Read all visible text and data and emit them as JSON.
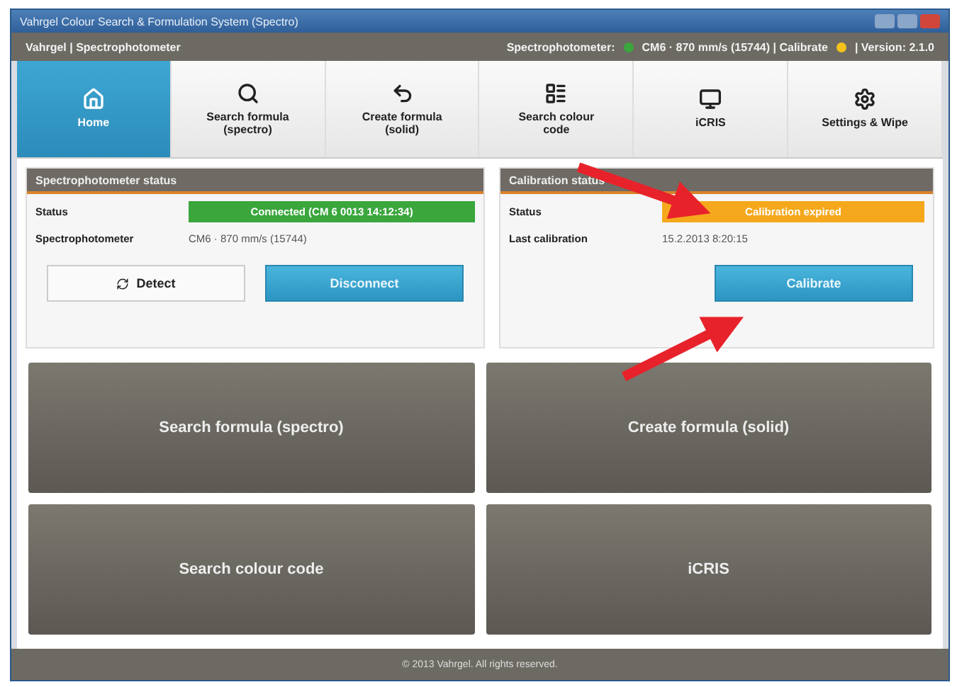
{
  "window": {
    "title": "Vahrgel Colour Search & Formulation System (Spectro)"
  },
  "header": {
    "left": "Vahrgel | Spectrophotometer",
    "device_label": "Spectrophotometer:",
    "device_info": "CM6 · 870 mm/s (15744) | Calibrate",
    "version": "| Version: 2.1.0"
  },
  "tabs": [
    {
      "label": "Home",
      "selected": true
    },
    {
      "label": "Search formula (spectro)",
      "selected": false
    },
    {
      "label": "Create formula (solid)",
      "selected": false
    },
    {
      "label": "Search colour code",
      "selected": false
    },
    {
      "label": "iCRIS",
      "selected": false
    },
    {
      "label": "Settings & Wipe",
      "selected": false
    }
  ],
  "panels": [
    {
      "title": "Spectrophotometer status",
      "rows": [
        {
          "label": "Status",
          "value": "Connected (CM 6 0013 14:12:34)",
          "kind": "badge",
          "color": "#3aa63c"
        },
        {
          "label": "Spectrophotometer",
          "value": "CM6 · 870 mm/s (15744)",
          "kind": "text"
        }
      ],
      "buttons": [
        {
          "label": "Detect",
          "kind": "plain"
        },
        {
          "label": "Disconnect",
          "kind": "primary"
        }
      ]
    },
    {
      "title": "Calibration status",
      "rows": [
        {
          "label": "Status",
          "value": "Calibration expired",
          "kind": "badge",
          "color": "#f5a81c"
        },
        {
          "label": "Last calibration",
          "value": "15.2.2013 8:20:15",
          "kind": "text"
        }
      ],
      "buttons": [
        {
          "label": "Calibrate",
          "kind": "primary"
        }
      ]
    }
  ],
  "tiles": [
    "Search formula (spectro)",
    "Create formula (solid)",
    "Search colour code",
    "iCRIS"
  ],
  "footer": "© 2013 Vahrgel. All rights reserved."
}
